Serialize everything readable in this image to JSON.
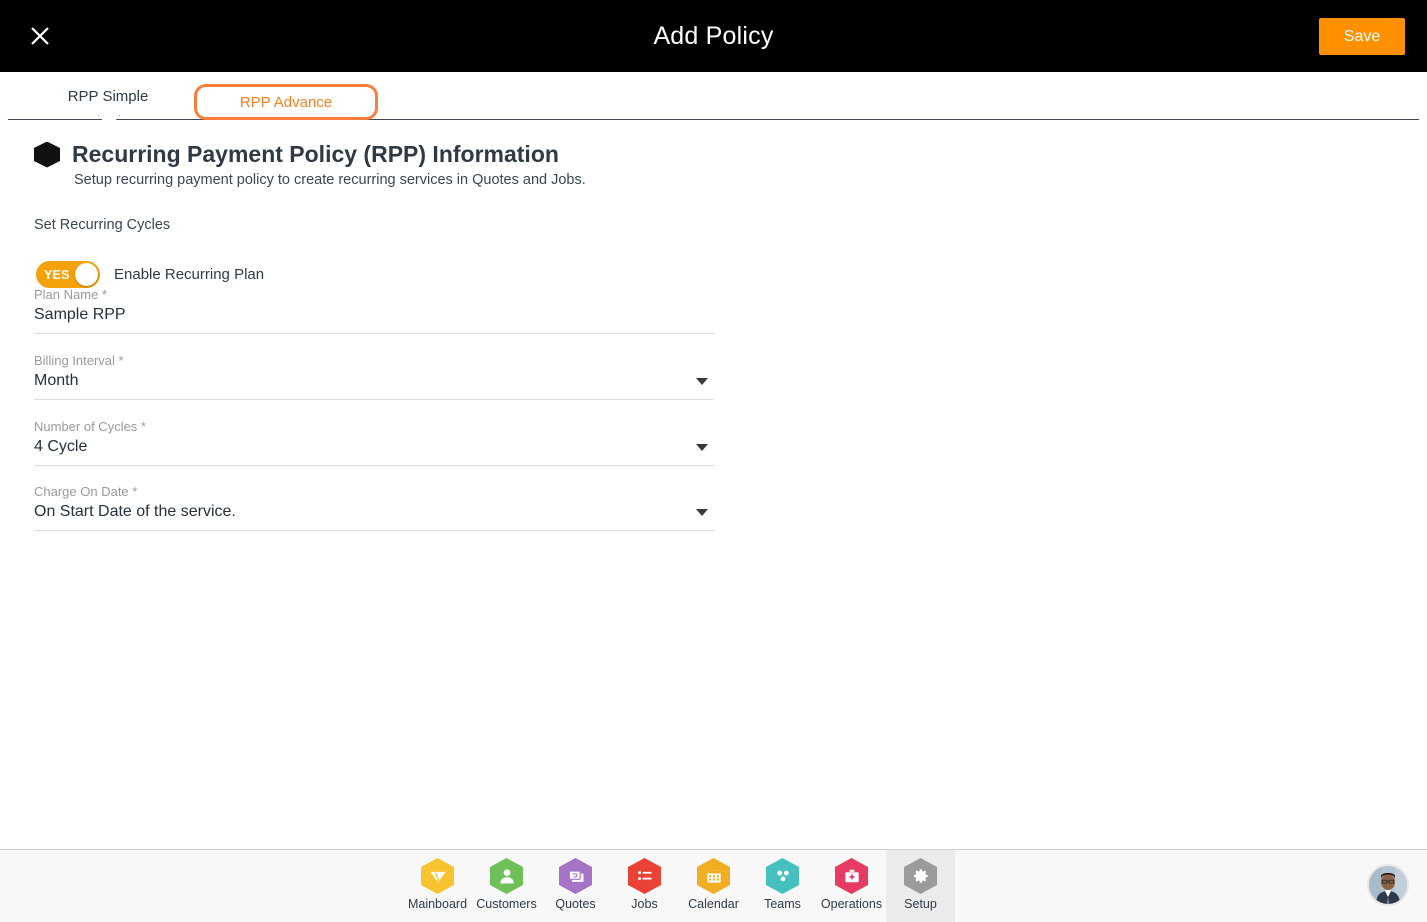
{
  "header": {
    "close_icon": "close-icon",
    "title": "Add Policy",
    "save_label": "Save",
    "accent_color": "#ff9100",
    "background": "#000000"
  },
  "tabs": [
    {
      "label": "RPP Simple",
      "active": false,
      "name": "tab-rpp-simple"
    },
    {
      "label": "RPP Advance",
      "active": true,
      "name": "tab-rpp-advance",
      "highlight_color": "#f97d3c",
      "text_color": "#f58220"
    }
  ],
  "section": {
    "bullet_icon": "hexagon-bullet-icon",
    "title": "Recurring Payment Policy (RPP) Information",
    "subtitle": "Setup recurring payment policy to create recurring services in Quotes and Jobs.",
    "group_label": "Set Recurring Cycles"
  },
  "toggle": {
    "state_label": "YES",
    "label": "Enable Recurring Plan",
    "on": true,
    "color": "#f5a20a"
  },
  "fields": [
    {
      "name": "plan-name-field",
      "label": "Plan Name *",
      "value": "Sample RPP",
      "placeholder": "Plan Name",
      "dropdown": false
    },
    {
      "name": "billing-interval-field",
      "label": "Billing Interval *",
      "value": "Month",
      "placeholder": "Billing Interval",
      "dropdown": true
    },
    {
      "name": "number-of-cycles-field",
      "label": "Number of Cycles *",
      "value": "4 Cycle",
      "placeholder": "Number of Cycles",
      "dropdown": true
    },
    {
      "name": "charge-on-date-field",
      "label": "Charge On Date *",
      "value": "On Start Date of the service.",
      "placeholder": "Charge On Date",
      "dropdown": true
    }
  ],
  "bottom_nav": {
    "items": [
      {
        "label": "Mainboard",
        "icon": "mainboard-icon",
        "color": "#f7c32e",
        "active": false
      },
      {
        "label": "Customers",
        "icon": "customers-icon",
        "color": "#6fbf5b",
        "active": false
      },
      {
        "label": "Quotes",
        "icon": "quotes-icon",
        "color": "#a574c7",
        "active": false
      },
      {
        "label": "Jobs",
        "icon": "jobs-icon",
        "color": "#ea4335",
        "active": false
      },
      {
        "label": "Calendar",
        "icon": "calendar-icon",
        "color": "#f1ae20",
        "active": false
      },
      {
        "label": "Teams",
        "icon": "teams-icon",
        "color": "#46bfbf",
        "active": false
      },
      {
        "label": "Operations",
        "icon": "operations-icon",
        "color": "#e63b62",
        "active": false
      },
      {
        "label": "Setup",
        "icon": "gear-icon",
        "color": "#9b9b9b",
        "active": true
      }
    ],
    "avatar": "user-avatar"
  }
}
